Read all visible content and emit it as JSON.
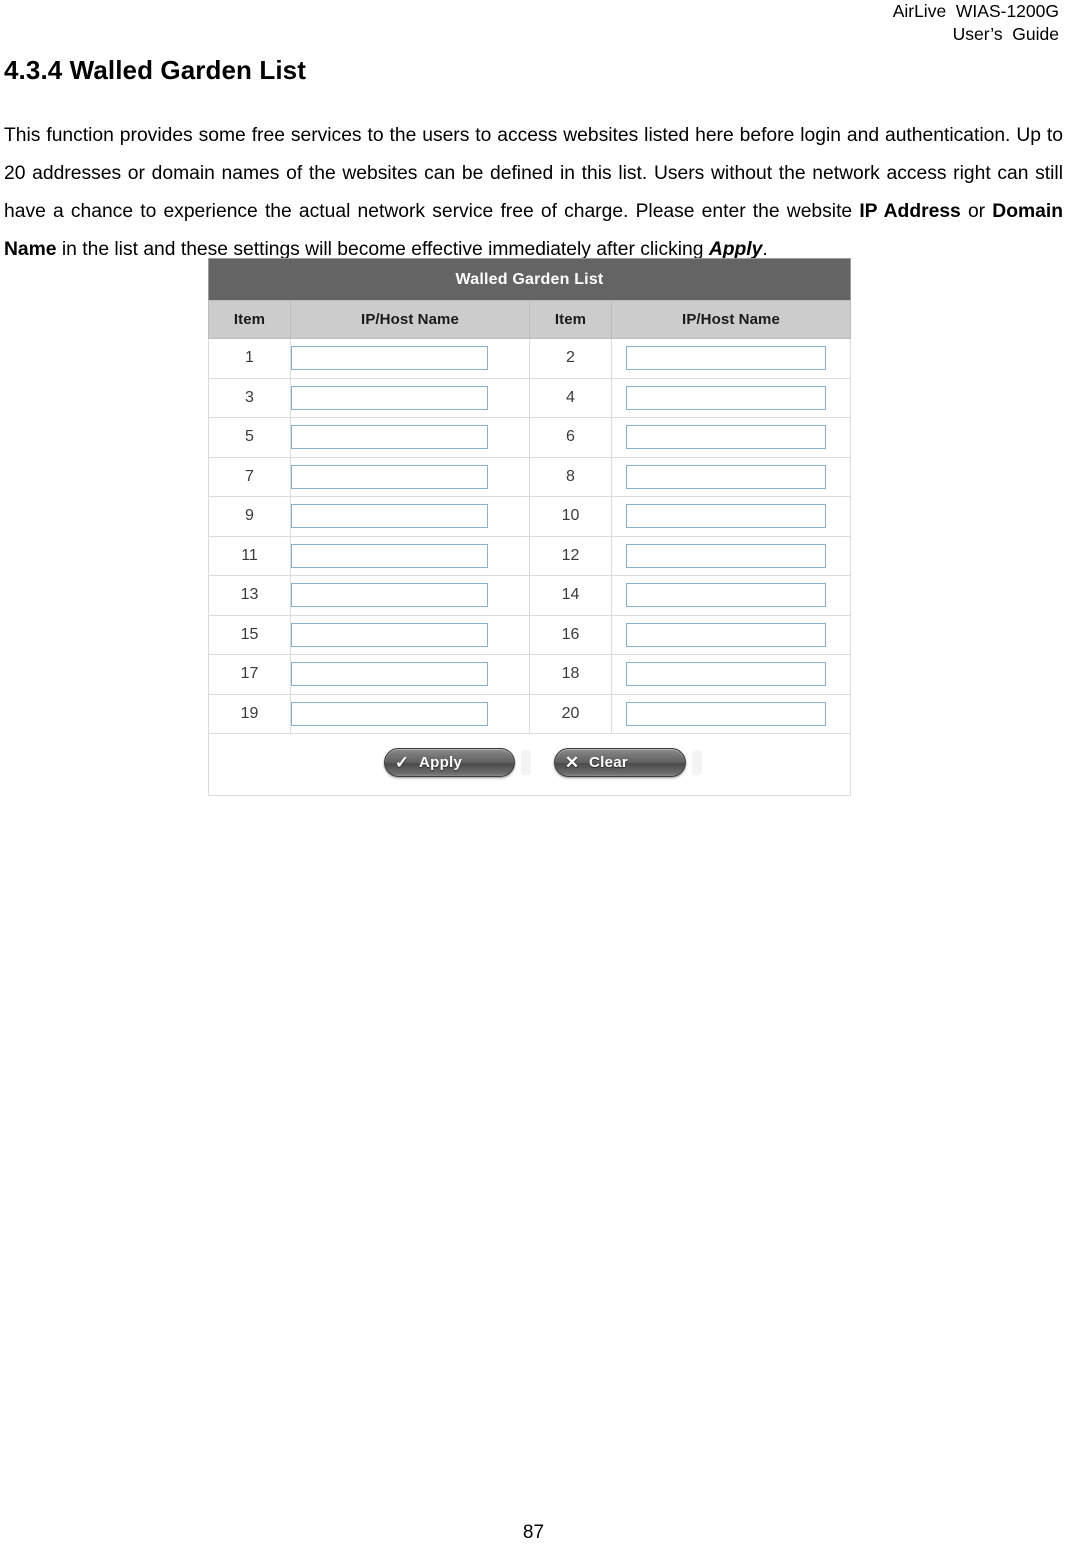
{
  "header": {
    "line1": "AirLive  WIAS-1200G",
    "line2": "User’s  Guide"
  },
  "section": {
    "number": "4.3.4",
    "title": "4.3.4 Walled Garden List"
  },
  "paragraph": {
    "part1": "This function provides some free services to the users to access websites listed here before login and authentication. Up to 20 addresses or domain names of the websites can be defined in this list. Users without the network access right can still have a chance to experience the actual network service free of charge. Please enter the website ",
    "bold1": "IP Address",
    "mid1": " or ",
    "bold2": "Domain Name",
    "mid2": " in the list and these settings will become effective immediately after clicking ",
    "bolditalic": "Apply",
    "end": "."
  },
  "panel": {
    "title": "Walled Garden List",
    "columns": [
      "Item",
      "IP/Host Name",
      "Item",
      "IP/Host Name"
    ],
    "rows": [
      {
        "left_item": "1",
        "left_value": "",
        "right_item": "2",
        "right_value": ""
      },
      {
        "left_item": "3",
        "left_value": "",
        "right_item": "4",
        "right_value": ""
      },
      {
        "left_item": "5",
        "left_value": "",
        "right_item": "6",
        "right_value": ""
      },
      {
        "left_item": "7",
        "left_value": "",
        "right_item": "8",
        "right_value": ""
      },
      {
        "left_item": "9",
        "left_value": "",
        "right_item": "10",
        "right_value": ""
      },
      {
        "left_item": "11",
        "left_value": "",
        "right_item": "12",
        "right_value": ""
      },
      {
        "left_item": "13",
        "left_value": "",
        "right_item": "14",
        "right_value": ""
      },
      {
        "left_item": "15",
        "left_value": "",
        "right_item": "16",
        "right_value": ""
      },
      {
        "left_item": "17",
        "left_value": "",
        "right_item": "18",
        "right_value": ""
      },
      {
        "left_item": "19",
        "left_value": "",
        "right_item": "20",
        "right_value": ""
      }
    ],
    "buttons": {
      "apply_label": "Apply",
      "apply_icon": "check-icon",
      "apply_glyph": "✓",
      "clear_label": "Clear",
      "clear_icon": "close-icon",
      "clear_glyph": "✕"
    },
    "colors": {
      "title_bar": "#646464",
      "column_header": "#cccccc",
      "row_background": "#ffffff",
      "input_border": "#8ab0d0",
      "grid_line": "#dcdcdc",
      "button_face": "#5d5d5d"
    }
  },
  "footer": {
    "page_number": "87"
  }
}
